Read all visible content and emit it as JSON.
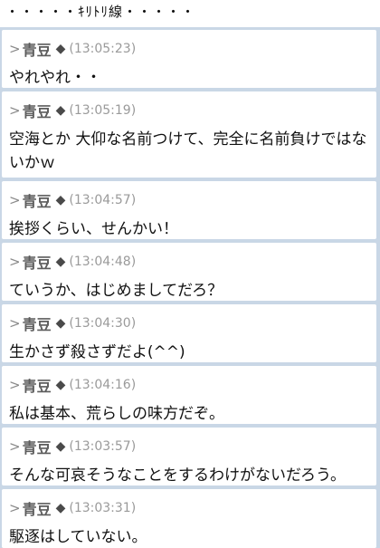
{
  "cut_line": "・・・・・ｷﾘﾄﾘ線・・・・・",
  "posts": [
    {
      "marker": ">",
      "name": "青豆",
      "trip": "◆",
      "time": "(13:05:23)",
      "message": "やれやれ・・"
    },
    {
      "marker": ">",
      "name": "青豆",
      "trip": "◆",
      "time": "(13:05:19)",
      "message": "空海とか 大仰な名前つけて、完全に名前負けではないかｗ"
    },
    {
      "marker": ">",
      "name": "青豆",
      "trip": "◆",
      "time": "(13:04:57)",
      "message": "挨拶くらい、せんかい！"
    },
    {
      "marker": ">",
      "name": "青豆",
      "trip": "◆",
      "time": "(13:04:48)",
      "message": "ていうか、はじめましてだろ？"
    },
    {
      "marker": ">",
      "name": "青豆",
      "trip": "◆",
      "time": "(13:04:30)",
      "message": "生かさず殺さずだよ(^^)"
    },
    {
      "marker": ">",
      "name": "青豆",
      "trip": "◆",
      "time": "(13:04:16)",
      "message": "私は基本、荒らしの味方だぞ。"
    },
    {
      "marker": ">",
      "name": "青豆",
      "trip": "◆",
      "time": "(13:03:57)",
      "message": "そんな可哀そうなことをするわけがないだろう。"
    },
    {
      "marker": ">",
      "name": "青豆",
      "trip": "◆",
      "time": "(13:03:31)",
      "message": "駆逐はしていない。"
    }
  ]
}
